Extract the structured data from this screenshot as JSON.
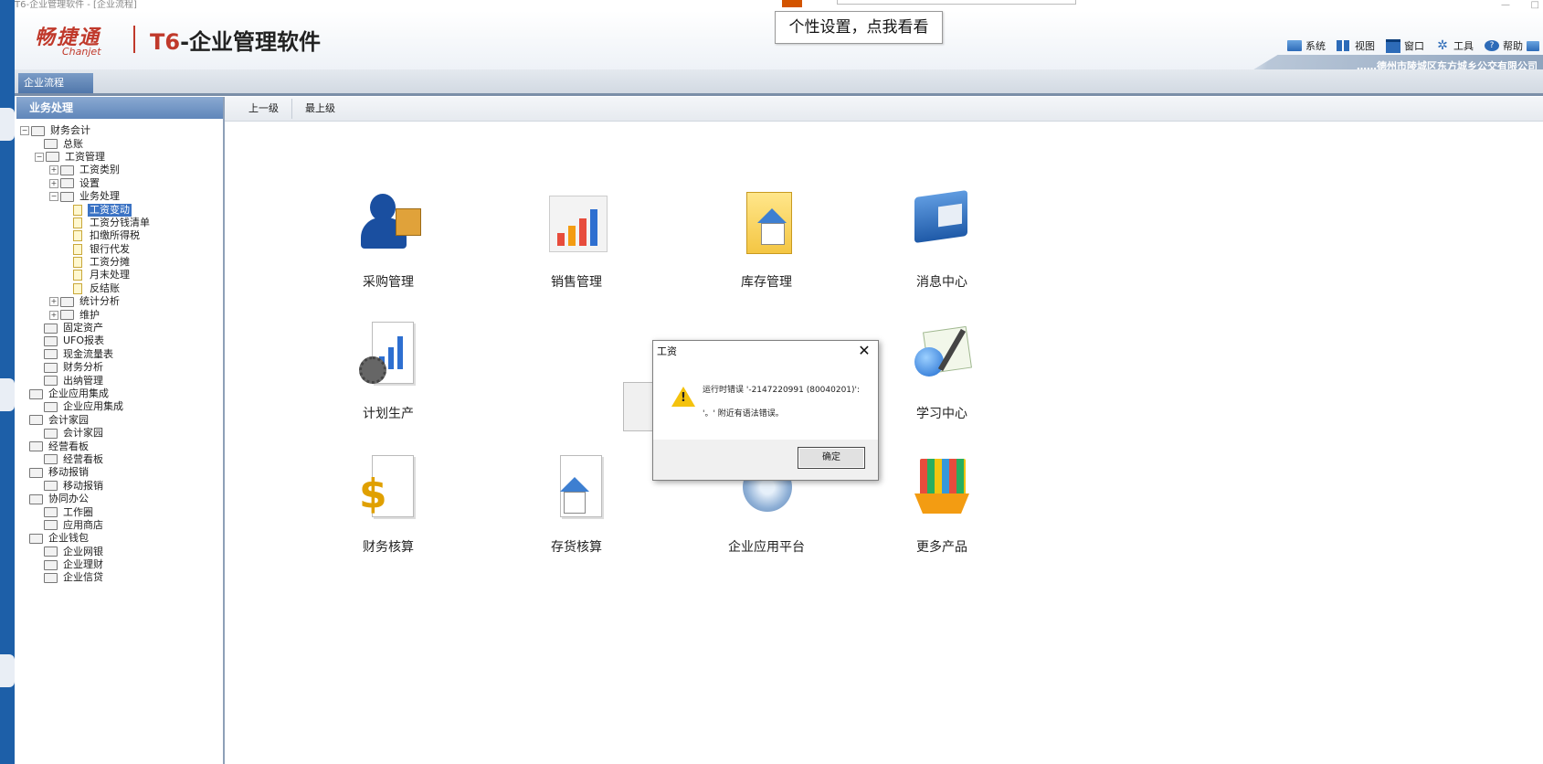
{
  "window": {
    "title": "T6-企业管理软件 - [企业流程]"
  },
  "header": {
    "logo_main": "畅捷通",
    "logo_sub": "Chanjet",
    "product_prefix": "T6",
    "product_name": "-企业管理软件",
    "tooltip": "个性设置，点我看看",
    "menu": [
      "系统",
      "视图",
      "窗口",
      "工具",
      "帮助"
    ],
    "company": "……德州市陵城区东方城乡公交有限公司"
  },
  "tab": {
    "label": "企业流程"
  },
  "left_pane": {
    "title": "业务处理",
    "tree": [
      {
        "label": "财务会计",
        "level": 0,
        "type": "folder",
        "expander": "-"
      },
      {
        "label": "总账",
        "level": 1,
        "type": "folder",
        "expander": ""
      },
      {
        "label": "工资管理",
        "level": 1,
        "type": "folder",
        "expander": "-"
      },
      {
        "label": "工资类别",
        "level": 2,
        "type": "folder",
        "expander": "+"
      },
      {
        "label": "设置",
        "level": 2,
        "type": "folder",
        "expander": "+"
      },
      {
        "label": "业务处理",
        "level": 2,
        "type": "folder",
        "expander": "-"
      },
      {
        "label": "工资变动",
        "level": 3,
        "type": "doc",
        "expander": "",
        "selected": true
      },
      {
        "label": "工资分钱清单",
        "level": 3,
        "type": "doc",
        "expander": ""
      },
      {
        "label": "扣缴所得税",
        "level": 3,
        "type": "doc",
        "expander": ""
      },
      {
        "label": "银行代发",
        "level": 3,
        "type": "doc",
        "expander": ""
      },
      {
        "label": "工资分摊",
        "level": 3,
        "type": "doc",
        "expander": ""
      },
      {
        "label": "月末处理",
        "level": 3,
        "type": "doc",
        "expander": ""
      },
      {
        "label": "反结账",
        "level": 3,
        "type": "doc",
        "expander": ""
      },
      {
        "label": "统计分析",
        "level": 2,
        "type": "folder",
        "expander": "+"
      },
      {
        "label": "维护",
        "level": 2,
        "type": "folder",
        "expander": "+"
      },
      {
        "label": "固定资产",
        "level": 1,
        "type": "folder",
        "expander": ""
      },
      {
        "label": "UFO报表",
        "level": 1,
        "type": "folder",
        "expander": ""
      },
      {
        "label": "现金流量表",
        "level": 1,
        "type": "folder",
        "expander": ""
      },
      {
        "label": "财务分析",
        "level": 1,
        "type": "folder",
        "expander": ""
      },
      {
        "label": "出纳管理",
        "level": 1,
        "type": "folder",
        "expander": ""
      },
      {
        "label": "企业应用集成",
        "level": 0,
        "type": "folder",
        "expander": ""
      },
      {
        "label": "企业应用集成",
        "level": 1,
        "type": "folder",
        "expander": ""
      },
      {
        "label": "会计家园",
        "level": 0,
        "type": "folder",
        "expander": ""
      },
      {
        "label": "会计家园",
        "level": 1,
        "type": "folder",
        "expander": ""
      },
      {
        "label": "经营看板",
        "level": 0,
        "type": "folder",
        "expander": ""
      },
      {
        "label": "经营看板",
        "level": 1,
        "type": "folder",
        "expander": ""
      },
      {
        "label": "移动报销",
        "level": 0,
        "type": "folder",
        "expander": ""
      },
      {
        "label": "移动报销",
        "level": 1,
        "type": "folder",
        "expander": ""
      },
      {
        "label": "协同办公",
        "level": 0,
        "type": "folder",
        "expander": ""
      },
      {
        "label": "工作圈",
        "level": 1,
        "type": "folder",
        "expander": ""
      },
      {
        "label": "应用商店",
        "level": 1,
        "type": "folder",
        "expander": ""
      },
      {
        "label": "企业钱包",
        "level": 0,
        "type": "folder",
        "expander": ""
      },
      {
        "label": "企业网银",
        "level": 1,
        "type": "folder",
        "expander": ""
      },
      {
        "label": "企业理财",
        "level": 1,
        "type": "folder",
        "expander": ""
      },
      {
        "label": "企业信贷",
        "level": 1,
        "type": "folder",
        "expander": ""
      }
    ]
  },
  "nav": {
    "up_label": "上一级",
    "top_label": "最上级"
  },
  "modules": {
    "purchase": "采购管理",
    "sales": "销售管理",
    "inventory": "库存管理",
    "messages": "消息中心",
    "planning": "计划生产",
    "learning": "学习中心",
    "finance": "财务核算",
    "stock_accounting": "存货核算",
    "platform": "企业应用平台",
    "more": "更多产品"
  },
  "dialog": {
    "title": "工资",
    "line1": "运行时错误 '-2147220991 (80040201)':",
    "line2": "'。' 附近有语法错误。",
    "ok_label": "确定"
  }
}
